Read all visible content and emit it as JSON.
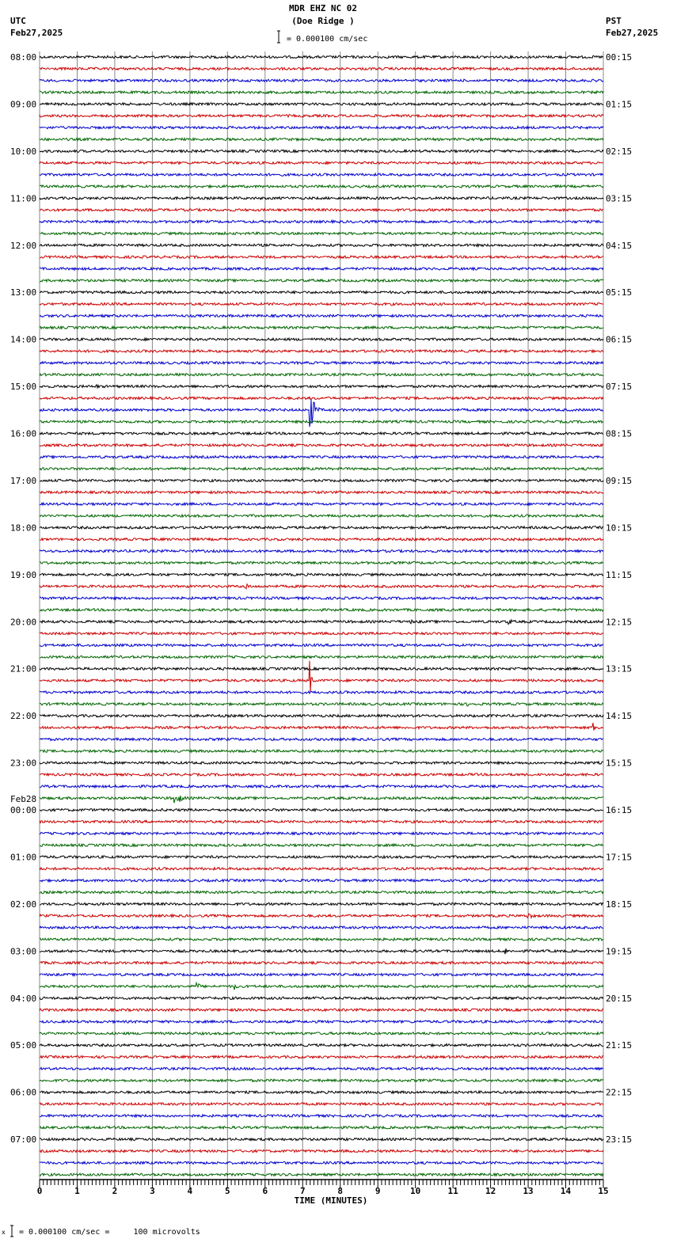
{
  "header": {
    "title": "MDR EHZ NC 02",
    "subtitle": "(Doe Ridge )",
    "left_tz": "UTC",
    "left_date": "Feb27,2025",
    "right_tz": "PST",
    "right_date": "Feb27,2025",
    "scale_text": "= 0.000100 cm/sec"
  },
  "footer": {
    "scale_text": "= 0.000100 cm/sec =     100 microvolts",
    "scale_prefix": "x"
  },
  "chart_data": {
    "type": "line",
    "title": "MDR EHZ NC 02 (Doe Ridge )",
    "xlabel": "TIME (MINUTES)",
    "xlim": [
      0,
      15
    ],
    "x_ticks": [
      "0",
      "1",
      "2",
      "3",
      "4",
      "5",
      "6",
      "7",
      "8",
      "9",
      "10",
      "11",
      "12",
      "13",
      "14",
      "15"
    ],
    "trace_minutes": 15,
    "traces_per_hour": 4,
    "trace_count": 96,
    "trace_colors": [
      "#000000",
      "#cc0000",
      "#0000cc",
      "#006600"
    ],
    "left_labels": [
      "08:00",
      "09:00",
      "10:00",
      "11:00",
      "12:00",
      "13:00",
      "14:00",
      "15:00",
      "16:00",
      "17:00",
      "18:00",
      "19:00",
      "20:00",
      "21:00",
      "22:00",
      "23:00",
      "00:00",
      "01:00",
      "02:00",
      "03:00",
      "04:00",
      "05:00",
      "06:00",
      "07:00"
    ],
    "date_change_label": "Feb28",
    "date_change_hour_index": 16,
    "right_labels": [
      "00:15",
      "01:15",
      "02:15",
      "03:15",
      "04:15",
      "05:15",
      "06:15",
      "07:15",
      "08:15",
      "09:15",
      "10:15",
      "11:15",
      "12:15",
      "13:15",
      "14:15",
      "15:15",
      "16:15",
      "17:15",
      "18:15",
      "19:15",
      "20:15",
      "21:15",
      "22:15",
      "23:15"
    ],
    "events": [
      {
        "trace": 28,
        "minute": 1.5,
        "amplitude": 3,
        "duration": 0.6
      },
      {
        "trace": 28,
        "minute": 4.4,
        "amplitude": 3,
        "duration": 0.1
      },
      {
        "trace": 30,
        "minute": 7.2,
        "amplitude": 30,
        "duration": 0.4
      },
      {
        "trace": 30,
        "minute": 9.5,
        "amplitude": 3,
        "duration": 0.3
      },
      {
        "trace": 45,
        "minute": 5.5,
        "amplitude": 8,
        "duration": 0.15
      },
      {
        "trace": 48,
        "minute": 9.9,
        "amplitude": 3,
        "duration": 0.3
      },
      {
        "trace": 48,
        "minute": 12.5,
        "amplitude": 4,
        "duration": 0.6
      },
      {
        "trace": 53,
        "minute": 7.2,
        "amplitude": 25,
        "duration": 0.15
      },
      {
        "trace": 55,
        "minute": 11.4,
        "amplitude": 3,
        "duration": 0.4
      },
      {
        "trace": 57,
        "minute": 14.7,
        "amplitude": 8,
        "duration": 0.5
      },
      {
        "trace": 63,
        "minute": 3.6,
        "amplitude": 10,
        "duration": 0.7
      },
      {
        "trace": 61,
        "minute": 11.6,
        "amplitude": 5,
        "duration": 0.1
      },
      {
        "trace": 73,
        "minute": 13.0,
        "amplitude": 4,
        "duration": 0.8
      },
      {
        "trace": 76,
        "minute": 12.4,
        "amplitude": 5,
        "duration": 0.2
      },
      {
        "trace": 79,
        "minute": 4.2,
        "amplitude": 5,
        "duration": 0.4
      },
      {
        "trace": 79,
        "minute": 5.2,
        "amplitude": 5,
        "duration": 0.3
      }
    ]
  }
}
